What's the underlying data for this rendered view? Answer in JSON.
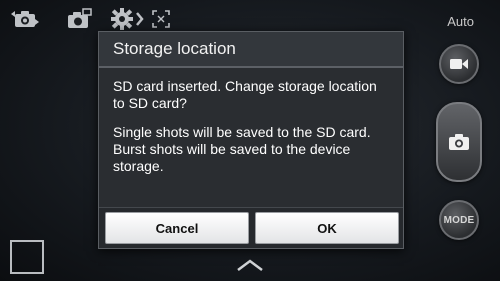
{
  "camera": {
    "mode_auto_label": "Auto",
    "mode_button_label": "MODE",
    "icons": {
      "switch_camera": "switch-camera-icon",
      "shortcut": "camera-shortcut-icon",
      "settings": "gear-icon",
      "focus": "focus-icon",
      "video": "video-camera-icon",
      "shutter": "camera-icon",
      "gallery": "gallery-thumbnail",
      "expand": "chevron-up-icon"
    }
  },
  "dialog": {
    "title": "Storage location",
    "message_1": "SD card inserted. Change storage location to SD card?",
    "message_2": "Single shots will be saved to the SD card. Burst shots will be saved to the device storage.",
    "cancel_label": "Cancel",
    "ok_label": "OK"
  },
  "colors": {
    "dialog_bg": "#2a2d31",
    "button_bg": "#ffffff",
    "text": "#ffffff"
  }
}
